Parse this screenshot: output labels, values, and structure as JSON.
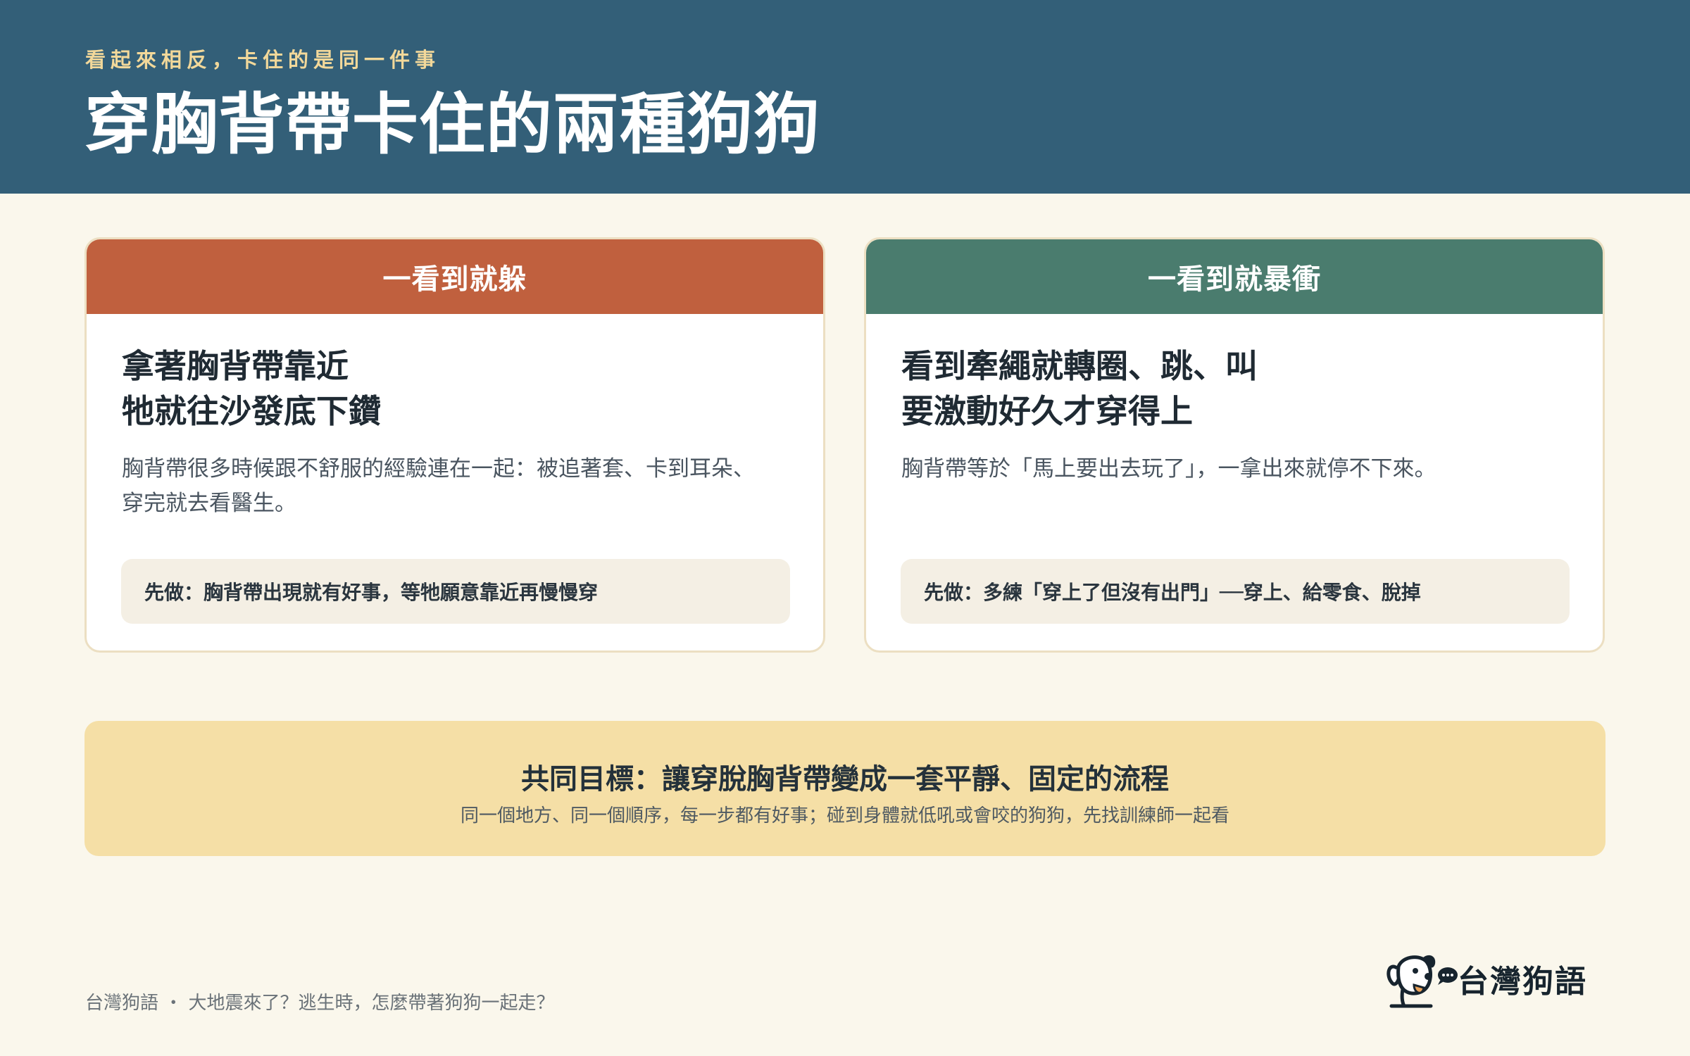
{
  "header": {
    "kicker": "看起來相反，卡住的是同一件事",
    "title": "穿胸背帶卡住的兩種狗狗"
  },
  "cards": [
    {
      "heading": "一看到就躲",
      "title_line1": "拿著胸背帶靠近",
      "title_line2": "牠就往沙發底下鑽",
      "desc_line1": "胸背帶很多時候跟不舒服的經驗連在一起：被追著套、卡到耳朵、",
      "desc_line2": "穿完就去看醫生。",
      "note": "先做：胸背帶出現就有好事，等牠願意靠近再慢慢穿",
      "accent": "#c0603e"
    },
    {
      "heading": "一看到就暴衝",
      "title_line1": "看到牽繩就轉圈、跳、叫",
      "title_line2": "要激動好久才穿得上",
      "desc_line1": "胸背帶等於「馬上要出去玩了」，一拿出來就停不下來。",
      "desc_line2": "",
      "note": "先做：多練「穿上了但沒有出門」──穿上、給零食、脫掉",
      "accent": "#4a7c6e"
    }
  ],
  "goal": {
    "title": "共同目標：讓穿脫胸背帶變成一套平靜、固定的流程",
    "subtitle": "同一個地方、同一個順序，每一步都有好事；碰到身體就低吼或會咬的狗狗，先找訓練師一起看"
  },
  "footer": {
    "text": "台灣狗語 ・ 大地震來了？逃生時，怎麼帶著狗狗一起走？",
    "brand_name": "台灣狗語",
    "brand_icon": "dog-logo-icon"
  },
  "colors": {
    "header_bg": "#335f78",
    "kicker": "#f2d89a",
    "page_bg": "#faf7ec",
    "goal_bg": "#f5dfa6"
  }
}
